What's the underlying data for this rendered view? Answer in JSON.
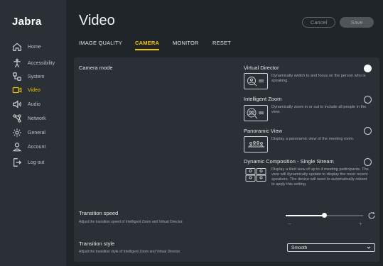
{
  "brand": "Jabra",
  "sidebar": {
    "items": [
      {
        "label": "Home",
        "icon": "home-icon"
      },
      {
        "label": "Accessibility",
        "icon": "accessibility-icon"
      },
      {
        "label": "System",
        "icon": "system-icon"
      },
      {
        "label": "Video",
        "icon": "video-camera-icon",
        "active": true
      },
      {
        "label": "Audio",
        "icon": "speaker-icon"
      },
      {
        "label": "Network",
        "icon": "network-icon"
      },
      {
        "label": "General",
        "icon": "gear-icon"
      },
      {
        "label": "Account",
        "icon": "user-icon"
      },
      {
        "label": "Log out",
        "icon": "logout-icon"
      }
    ]
  },
  "header": {
    "title": "Video",
    "cancel_label": "Cancel",
    "save_label": "Save"
  },
  "tabs": [
    {
      "label": "IMAGE QUALITY"
    },
    {
      "label": "CAMERA",
      "active": true
    },
    {
      "label": "MONITOR"
    },
    {
      "label": "RESET"
    }
  ],
  "camera_mode": {
    "label": "Camera mode",
    "options": [
      {
        "title": "Virtual Director",
        "desc": "Dynamically switch to and focus on the person who is speaking.",
        "selected": true
      },
      {
        "title": "Intelligent Zoom",
        "desc": "Dynamically zoom in or out to include all people in the view.",
        "selected": false
      },
      {
        "title": "Panoramic View",
        "desc": "Display a panoramic view of the meeting room.",
        "selected": false
      },
      {
        "title": "Dynamic Composition - Single Stream",
        "desc": "Display a tiled view of up to 4 meeting participants. The view will dynamically update to display the most recent speakers. The device will need to automatically reboot to apply this setting.",
        "selected": false
      }
    ]
  },
  "transition_speed": {
    "label": "Transition speed",
    "desc": "Adjust the transition speed of Intelligent Zoom and Virtual Director.",
    "value": 0.5,
    "minus": "−",
    "plus": "+"
  },
  "transition_style": {
    "label": "Transition style",
    "desc": "Adjust the transition style of Intelligent Zoom and Virtual Director.",
    "value": "Smooth"
  },
  "colors": {
    "accent": "#f5c400",
    "background": "#1f2529",
    "panel": "#2a3035"
  }
}
